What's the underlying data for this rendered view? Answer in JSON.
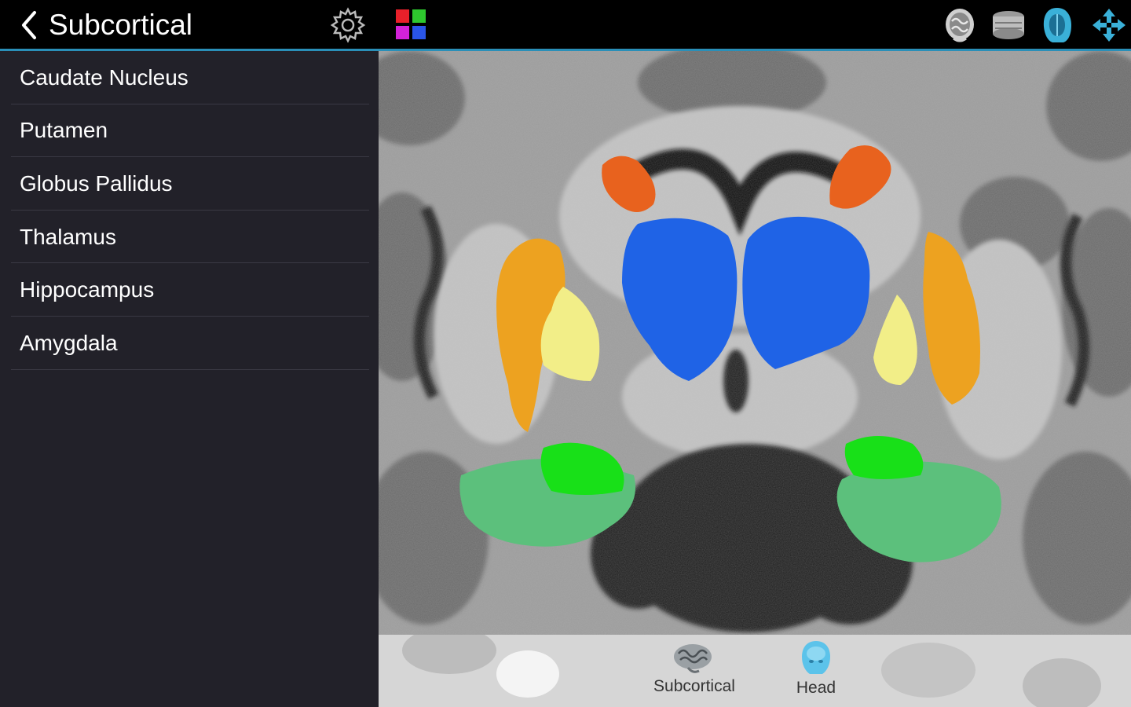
{
  "header": {
    "title": "Subcortical",
    "back_icon": "back-chevron-icon",
    "settings_icon": "gear-icon",
    "colors_icon": "color-grid-icon",
    "accent_color": "#2a8fb8"
  },
  "toolbar_right": [
    {
      "icon": "brain-3d-icon"
    },
    {
      "icon": "axial-slice-icon"
    },
    {
      "icon": "head-mri-icon"
    },
    {
      "icon": "move-arrows-icon"
    }
  ],
  "sidebar": {
    "items": [
      {
        "label": "Caudate Nucleus"
      },
      {
        "label": "Putamen"
      },
      {
        "label": "Globus Pallidus"
      },
      {
        "label": "Thalamus"
      },
      {
        "label": "Hippocampus"
      },
      {
        "label": "Amygdala"
      }
    ]
  },
  "structure_colors": {
    "caudate": "#e8621e",
    "putamen": "#eda220",
    "globus_pallidus": "#f2ee88",
    "thalamus": "#1f63e6",
    "hippocampus": "#5cc07c",
    "amygdala": "#18e018"
  },
  "bottom_nav": {
    "items": [
      {
        "label": "Subcortical",
        "icon": "brain-icon"
      },
      {
        "label": "Head",
        "icon": "head-icon"
      }
    ]
  }
}
